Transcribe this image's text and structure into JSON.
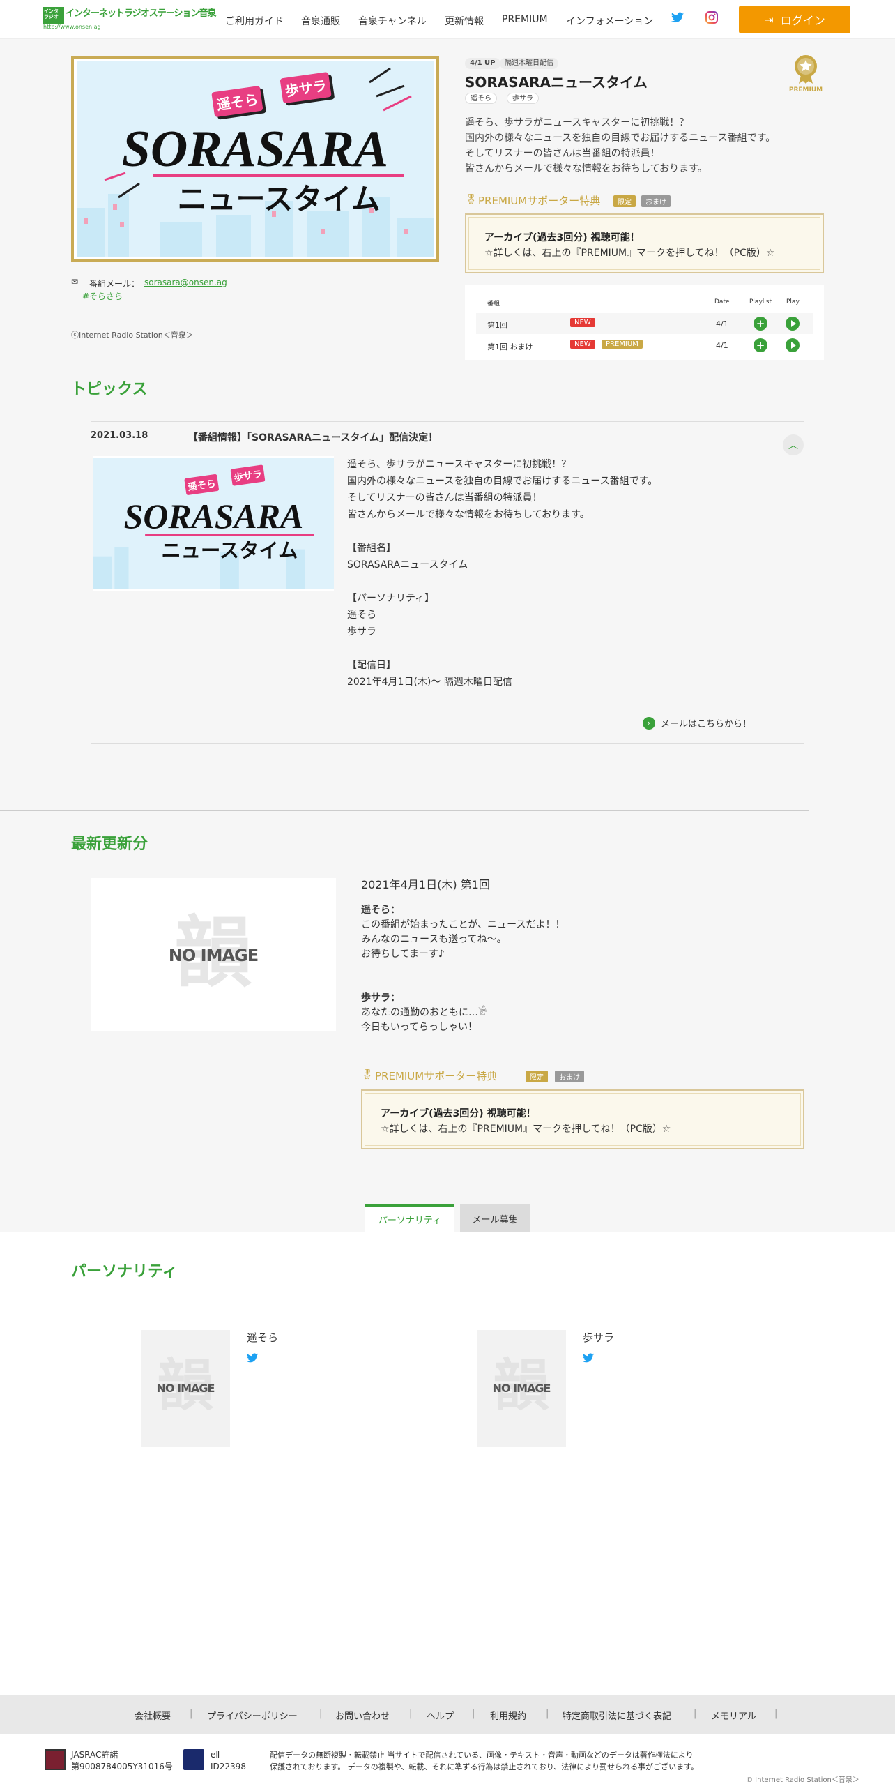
{
  "header": {
    "logo_text": "インターネットラジオステーション音泉",
    "logo_url": "http://www.onsen.ag",
    "nav": [
      "ご利用ガイド",
      "音泉通販",
      "音泉チャンネル",
      "更新情報",
      "PREMIUM",
      "インフォメーション"
    ],
    "login": "ログイン"
  },
  "program": {
    "updated": "4/1 UP",
    "schedule": "隔週木曜日配信",
    "title": "SORASARAニュースタイム",
    "performers": [
      "遥そら",
      "歩サラ"
    ],
    "desc": [
      "遥そら、歩サラがニュースキャスターに初挑戦！？",
      "国内外の様々なニュースを独自の目線でお届けするニュース番組です。",
      "そしてリスナーの皆さんは当番組の特派員！",
      "皆さんからメールで様々な情報をお待ちしております。"
    ],
    "mail_label": "番組メール：",
    "mail": "sorasara@onsen.ag",
    "hashtag": "#そらさら",
    "copyright": "ⓒInternet Radio Station＜音泉＞",
    "premium_badge": "PREMIUM",
    "image_title": "SORASARA",
    "image_subtitle": "ニュースタイム",
    "image_tag1": "遥そら",
    "image_tag2": "歩サラ"
  },
  "premium": {
    "heading": "PREMIUMサポーター特典",
    "badge1": "限定",
    "badge2": "おまけ",
    "line1": "アーカイブ(過去3回分) 視聴可能！",
    "line2": "☆詳しくは、右上の『PREMIUM』マークを押してね！（PC版）☆"
  },
  "episodes": {
    "headers": {
      "name": "番組",
      "date": "Date",
      "playlist": "Playlist",
      "play": "Play"
    },
    "rows": [
      {
        "name": "第1回",
        "badges": [
          "NEW"
        ],
        "date": "4/1"
      },
      {
        "name": "第1回 おまけ",
        "badges": [
          "NEW",
          "PREMIUM"
        ],
        "date": "4/1"
      }
    ]
  },
  "topics": {
    "heading": "トピックス",
    "date": "2021.03.18",
    "title": "【番組情報】「SORASARAニュースタイム」配信決定！",
    "body": [
      "遥そら、歩サラがニュースキャスターに初挑戦！？",
      "国内外の様々なニュースを独自の目線でお届けするニュース番組です。",
      "そしてリスナーの皆さんは当番組の特派員！",
      "皆さんからメールで様々な情報をお待ちしております。",
      "",
      "【番組名】",
      "SORASARAニュースタイム",
      "",
      "【パーソナリティ】",
      "遥そら",
      "歩サラ",
      "",
      "【配信日】",
      "2021年4月1日(木)～ 隔週木曜日配信"
    ],
    "mail_link": "メールはこちらから！"
  },
  "latest": {
    "heading": "最新更新分",
    "noimage": "NO IMAGE",
    "title": "2021年4月1日(木) 第1回",
    "block1_name": "遥そら：",
    "block1": [
      "この番組が始まったことが、ニュースだよ！！",
      "みんなのニュースも送ってね～。",
      "お待ちしてまーす♪"
    ],
    "block2_name": "歩サラ：",
    "block2": [
      "あなたの通勤のおともに…𓀀",
      "今日もいってらっしゃい！"
    ]
  },
  "tabs": [
    "パーソナリティ",
    "メール募集"
  ],
  "personality": {
    "heading": "パーソナリティ",
    "people": [
      {
        "name": "遥そら"
      },
      {
        "name": "歩サラ"
      }
    ]
  },
  "footer": {
    "links": [
      "会社概要",
      "プライバシーポリシー",
      "お問い合わせ",
      "ヘルプ",
      "利用規約",
      "特定商取引法に基づく表記",
      "メモリアル"
    ],
    "jasrac": "JASRAC許諾",
    "jasrac_no": "第9008784005Y31016号",
    "nex": "eⅡ",
    "nex_no": "ID22398",
    "notice1": "配信データの無断複製・転載禁止 当サイトで配信されている、画像・テキスト・音声・動画などのデータは著作権法により",
    "notice2": "保護されております。 データの複製や、転載、それに準ずる行為は禁止されており、法律により罰せられる事がございます。",
    "copyright": "© Internet Radio Station＜音泉＞"
  }
}
